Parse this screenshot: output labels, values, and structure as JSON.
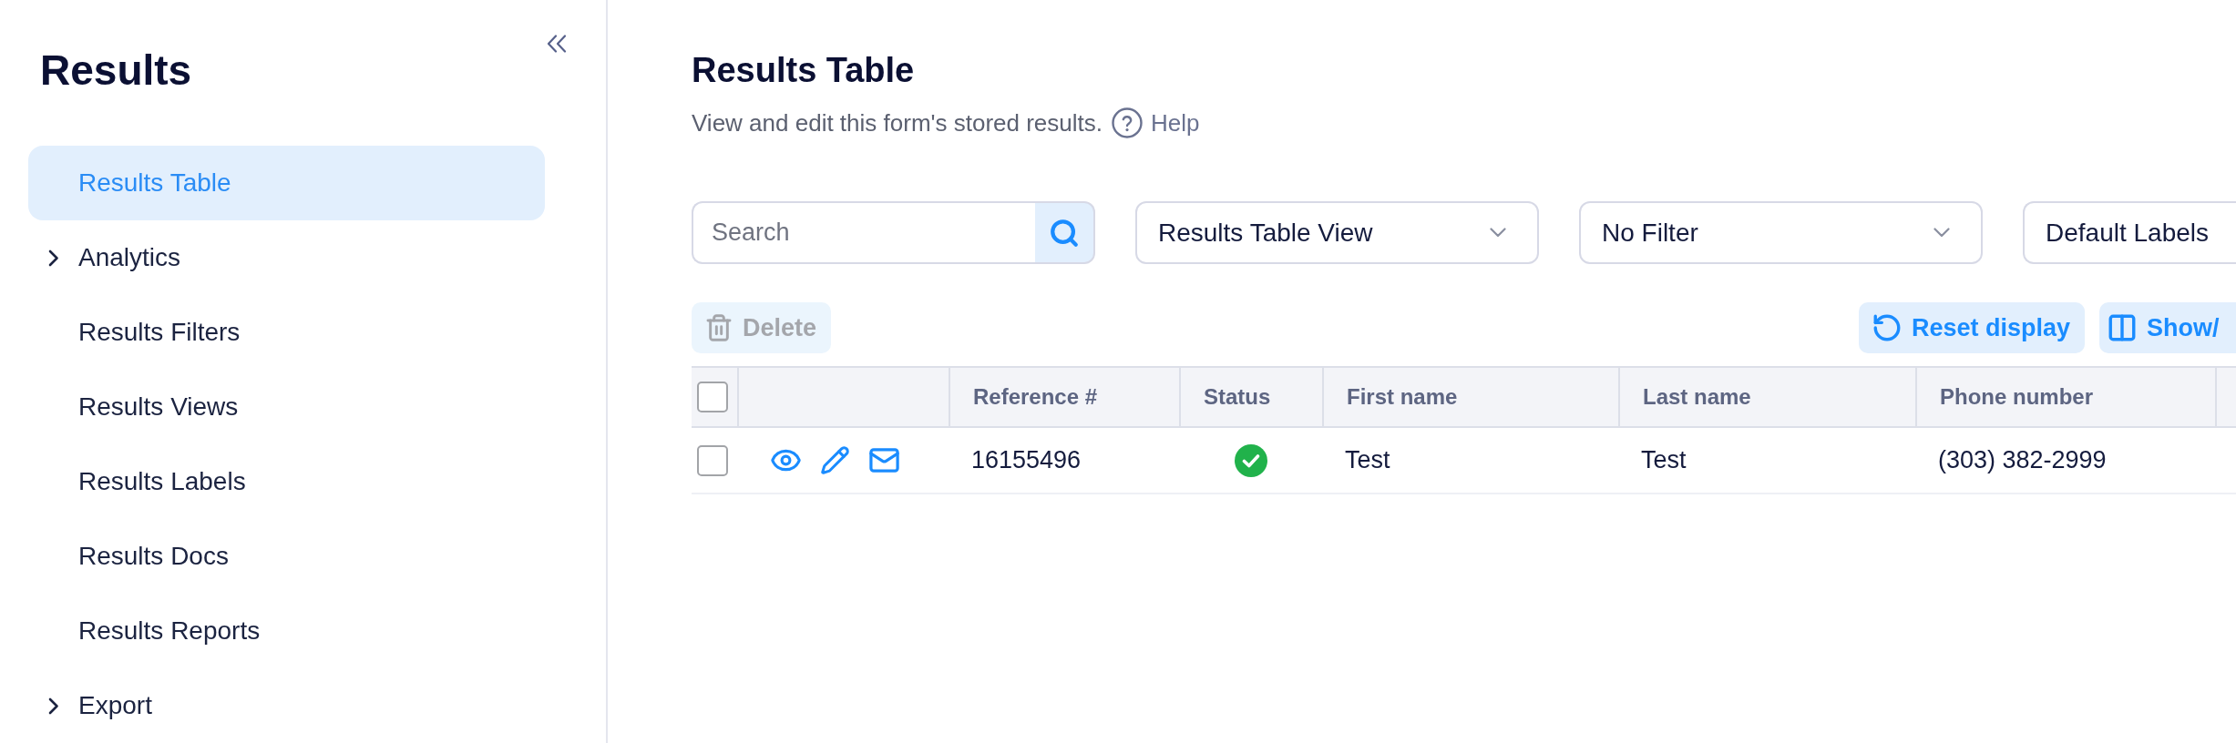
{
  "sidebar": {
    "title": "Results",
    "items": [
      {
        "label": "Results Table",
        "kind": "page",
        "selected": true
      },
      {
        "label": "Analytics",
        "kind": "group",
        "selected": false
      },
      {
        "label": "Results Filters",
        "kind": "page",
        "selected": false
      },
      {
        "label": "Results Views",
        "kind": "page",
        "selected": false
      },
      {
        "label": "Results Labels",
        "kind": "page",
        "selected": false
      },
      {
        "label": "Results Docs",
        "kind": "page",
        "selected": false
      },
      {
        "label": "Results Reports",
        "kind": "page",
        "selected": false
      },
      {
        "label": "Export",
        "kind": "group",
        "selected": false
      }
    ]
  },
  "header": {
    "title": "Results Table",
    "description": "View and edit this form's stored results.",
    "help_link": "Help"
  },
  "toolbar": {
    "search": {
      "placeholder": "Search"
    },
    "dropdowns": [
      {
        "value": "Results Table View"
      },
      {
        "value": "No Filter"
      },
      {
        "value": "Default Labels"
      }
    ]
  },
  "actions": {
    "delete": {
      "label": "Delete",
      "disabled": true
    },
    "buttons": [
      {
        "kind": "reset",
        "label": "Reset display"
      },
      {
        "kind": "columns",
        "label": "Show/"
      }
    ]
  },
  "table": {
    "select_all": {
      "checked": false
    },
    "columns": [
      "Reference #",
      "Status",
      "First name",
      "Last name",
      "Phone number"
    ],
    "rows": [
      {
        "checked": false,
        "reference": "16155496",
        "complete": true,
        "first_name": "Test",
        "last_name": "Test",
        "phone": "(303) 382-2999"
      }
    ]
  }
}
